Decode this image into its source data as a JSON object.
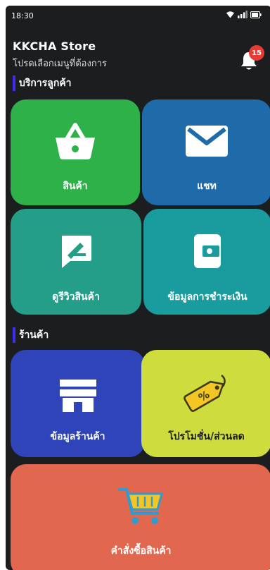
{
  "status_bar": {
    "time": "18:30"
  },
  "header": {
    "store_name": "KKCHA Store",
    "subtitle": "โปรดเลือกเมนูที่ต้องการ",
    "notification_count": "15"
  },
  "sections": {
    "customer_service": "บริการลูกค้า",
    "store": "ร้านค้า"
  },
  "tiles": {
    "products": {
      "label": "สินค้า",
      "icon": "basket-icon",
      "color": "#2fb14a"
    },
    "chat": {
      "label": "แชท",
      "icon": "envelope-icon",
      "color": "#1f6aa8"
    },
    "reviews": {
      "label": "ดูรีวิวสินค้า",
      "icon": "edit-review-icon",
      "color": "#249e89"
    },
    "payment": {
      "label": "ข้อมูลการชำระเงิน",
      "icon": "wallet-icon",
      "color": "#1a9c9e"
    },
    "store_info": {
      "label": "ข้อมูลร้านค้า",
      "icon": "storefront-icon",
      "color": "#2f44b8"
    },
    "promotions": {
      "label": "โปรโมชั่น/ส่วนลด",
      "icon": "discount-tag-icon",
      "color": "#cfdc3d"
    },
    "orders": {
      "label": "คำสั่งซื้อสินค้า",
      "icon": "shopping-cart-icon",
      "color": "#e2674f"
    }
  }
}
